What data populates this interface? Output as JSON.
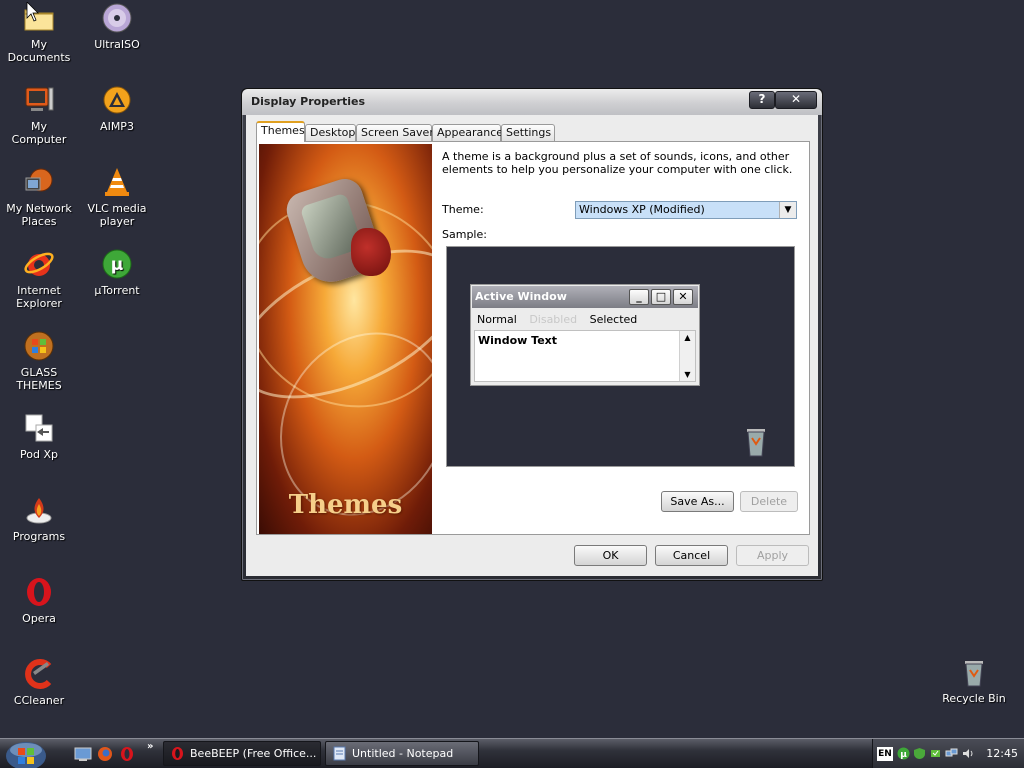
{
  "desktop": {
    "icons": [
      {
        "label": "My Documents",
        "icon": "folder-icon"
      },
      {
        "label": "UltraISO",
        "icon": "disc-icon"
      },
      {
        "label": "My Computer",
        "icon": "computer-icon"
      },
      {
        "label": "AIMP3",
        "icon": "aimp-icon"
      },
      {
        "label": "My Network Places",
        "icon": "network-icon"
      },
      {
        "label": "VLC media player",
        "icon": "vlc-cone-icon"
      },
      {
        "label": "Internet Explorer",
        "icon": "ie-icon"
      },
      {
        "label": "µTorrent",
        "icon": "utorrent-icon"
      },
      {
        "label": "GLASS THEMES",
        "icon": "windows-orb-icon"
      },
      {
        "label": "Pod Xp",
        "icon": "document-icon"
      },
      {
        "label": "Programs",
        "icon": "programs-icon"
      },
      {
        "label": "Opera",
        "icon": "opera-icon"
      },
      {
        "label": "CCleaner",
        "icon": "ccleaner-icon"
      }
    ],
    "recycle_bin": {
      "label": "Recycle Bin",
      "icon": "recycle-bin-icon"
    }
  },
  "dialog": {
    "title": "Display Properties",
    "help_button": "?",
    "close_button": "✕",
    "tabs": [
      {
        "label": "Themes",
        "active": true
      },
      {
        "label": "Desktop",
        "active": false
      },
      {
        "label": "Screen Saver",
        "active": false
      },
      {
        "label": "Appearance",
        "active": false
      },
      {
        "label": "Settings",
        "active": false
      }
    ],
    "art_title": "Themes",
    "description": "A theme is a background plus a set of sounds, icons, and other elements to help you personalize your computer with one click.",
    "theme_label": "Theme:",
    "theme_value": "Windows XP (Modified)",
    "sample_label": "Sample:",
    "sample": {
      "window_title": "Active Window",
      "menu": {
        "normal": "Normal",
        "disabled": "Disabled",
        "selected": "Selected"
      },
      "window_text": "Window Text",
      "min_btn": "_",
      "max_btn": "□",
      "close_btn": "✕"
    },
    "buttons": {
      "save_as": "Save As...",
      "delete": "Delete",
      "ok": "OK",
      "cancel": "Cancel",
      "apply": "Apply"
    }
  },
  "taskbar": {
    "chevron": "»",
    "tasks": [
      {
        "label": "BeeBEEP (Free Office...",
        "icon": "opera-icon",
        "active": true
      },
      {
        "label": "Untitled - Notepad",
        "icon": "notepad-icon",
        "active": false
      }
    ],
    "tray": {
      "language": "EN",
      "clock": "12:45"
    }
  },
  "colors": {
    "desktop_bg": "#2b2d3a",
    "theme_select_bg": "#c8e0f8",
    "active_tab_accent": "#e0a020"
  }
}
